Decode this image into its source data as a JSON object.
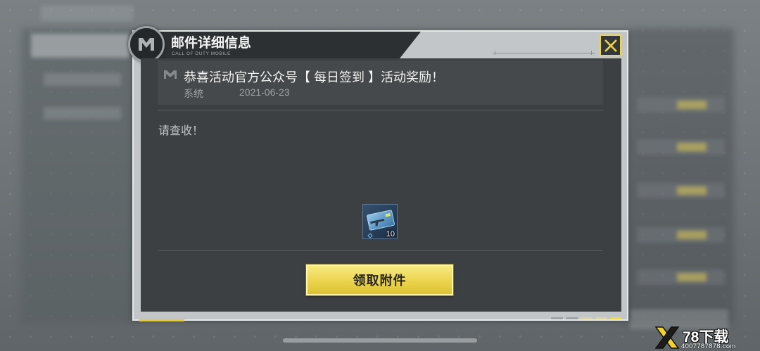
{
  "dialog": {
    "title": "邮件详细信息",
    "subtitle": "CALL OF DUTY MOBILE",
    "logo_icon": "cod-emblem-icon",
    "close_icon": "close-icon"
  },
  "mail": {
    "icon": "mail-emblem-icon",
    "subject": "恭喜活动官方公众号【 每日签到 】活动奖励！",
    "sender": "系统",
    "date": "2021-06-23",
    "body": "请查收！",
    "attachments": [
      {
        "icon": "weapon-card-icon",
        "count": "10"
      }
    ]
  },
  "actions": {
    "claim_label": "领取附件"
  },
  "watermark": {
    "logo_text": "78下载",
    "url": "4007787878.com"
  },
  "colors": {
    "accent": "#ebd44c",
    "panel": "#3d4042",
    "header_row": "#46494b",
    "button_text": "#262626"
  }
}
